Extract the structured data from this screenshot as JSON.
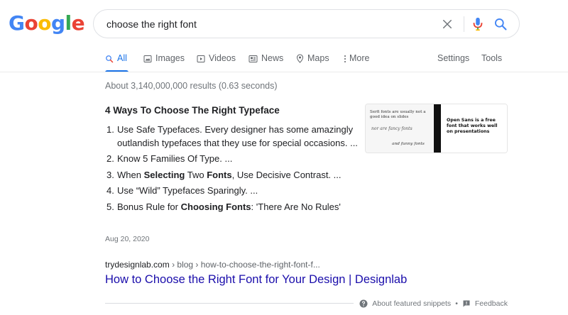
{
  "logo": {
    "letters": [
      "G",
      "o",
      "o",
      "g",
      "l",
      "e"
    ],
    "colors": [
      "#4285F4",
      "#EA4335",
      "#FBBC05",
      "#4285F4",
      "#34A853",
      "#EA4335"
    ]
  },
  "search": {
    "query": "choose the right font"
  },
  "tabs": [
    {
      "label": "All",
      "icon": "search-icon",
      "active": true
    },
    {
      "label": "Images",
      "icon": "image-icon"
    },
    {
      "label": "Videos",
      "icon": "video-icon"
    },
    {
      "label": "News",
      "icon": "news-icon"
    },
    {
      "label": "Maps",
      "icon": "map-pin-icon"
    },
    {
      "label": "More",
      "icon": "more-vertical-icon"
    }
  ],
  "tools": {
    "settings": "Settings",
    "tools": "Tools"
  },
  "result_stats": "About 3,140,000,000 results (0.63 seconds)",
  "snippet": {
    "title": "4 Ways To Choose The Right Typeface",
    "items": [
      {
        "num": "1.",
        "parts": [
          {
            "text": "Use Safe Typefaces. Every designer has some amazingly outlandish typefaces that they use for special occasions. ..."
          }
        ]
      },
      {
        "num": "2.",
        "parts": [
          {
            "text": "Know 5 Families Of Type. ..."
          }
        ]
      },
      {
        "num": "3.",
        "parts": [
          {
            "text": "When "
          },
          {
            "text": "Selecting",
            "bold": true
          },
          {
            "text": " Two "
          },
          {
            "text": "Fonts",
            "bold": true
          },
          {
            "text": ", Use Decisive Contrast. ..."
          }
        ]
      },
      {
        "num": "4.",
        "parts": [
          {
            "text": "Use “Wild” Typefaces Sparingly. ..."
          }
        ]
      },
      {
        "num": "5.",
        "parts": [
          {
            "text": "Bonus Rule for "
          },
          {
            "text": "Choosing Fonts",
            "bold": true
          },
          {
            "text": ": 'There Are No Rules'"
          }
        ]
      }
    ],
    "date": "Aug 20, 2020",
    "thumbnail": {
      "left_text": "Serfi fonts are usually not a good idea on slides",
      "script_text": "nor are fancy fonts",
      "small_text": "and funny fonts",
      "right_text": "Open Sans is a free font that works well on presentations"
    }
  },
  "result": {
    "url_domain": "trydesignlab.com",
    "url_path": "› blog › how-to-choose-the-right-font-f...",
    "title": "How to Choose the Right Font for Your Design | Designlab"
  },
  "footer": {
    "about": "About featured snippets",
    "dot": "•",
    "feedback": "Feedback"
  }
}
